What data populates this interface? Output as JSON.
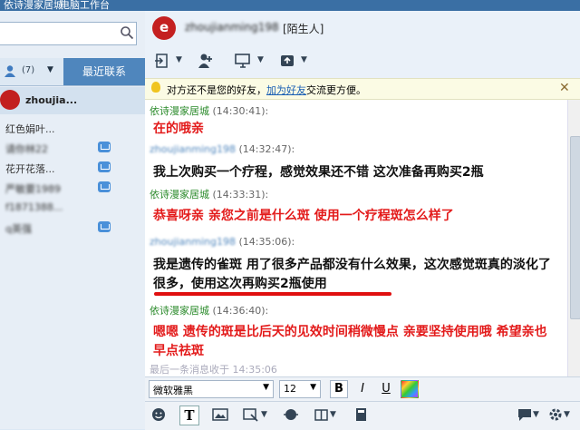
{
  "topbar": {
    "left_text": "依诗漫家居城",
    "right_text": "电脑工作台"
  },
  "left": {
    "search_placeholder": "",
    "tabs": {
      "contacts_count": "(7)",
      "recent_label": "最近联系"
    },
    "first_contact": "zhoujia...",
    "contacts": [
      {
        "name": "红色娟叶...",
        "mail": false
      },
      {
        "name": "请你林22",
        "mail": true
      },
      {
        "name": "花开花落...",
        "mail": true
      },
      {
        "name": "严敏要1989",
        "mail": true
      },
      {
        "name": "f1871388...",
        "mail": false
      },
      {
        "name": "q英强",
        "mail": true
      }
    ]
  },
  "chat_header": {
    "username": "zhoujianming198",
    "tag": "[陌生人]"
  },
  "notice": {
    "before": "对方还不是您的好友，",
    "link": "加为好友",
    "after": "交流更方便。"
  },
  "messages": [
    {
      "sender": "依诗漫家居城",
      "time": "(14:30:41):",
      "self": true,
      "text": "在的哦亲",
      "color": "#e31b1b"
    },
    {
      "sender": "zhoujianming198",
      "time": "(14:32:47):",
      "self": false,
      "text": "我上次购买一个疗程，感觉效果还不错 这次准备再购买2瓶",
      "color": "#111111"
    },
    {
      "sender": "依诗漫家居城",
      "time": "(14:33:31):",
      "self": true,
      "text": "恭喜呀亲 亲您之前是什么斑 使用一个疗程斑怎么样了",
      "color": "#e31b1b"
    },
    {
      "sender": "zhoujianming198",
      "time": "(14:35:06):",
      "self": false,
      "text": "我是遗传的雀斑 用了很多产品都没有什么效果，这次感觉斑真的淡化了很多，使用这次再购买2瓶使用",
      "color": "#111111"
    },
    {
      "sender": "依诗漫家居城",
      "time": "(14:36:40):",
      "self": true,
      "text": "嗯嗯 遗传的斑是比后天的见效时间稍微慢点 亲要坚持使用哦 希望亲也早点祛斑",
      "color": "#e31b1b"
    }
  ],
  "last_message": "最后一条消息收于 14:35:06",
  "format": {
    "font": "微软雅黑",
    "size": "12",
    "bold": "B",
    "italic": "I",
    "underline": "U"
  }
}
